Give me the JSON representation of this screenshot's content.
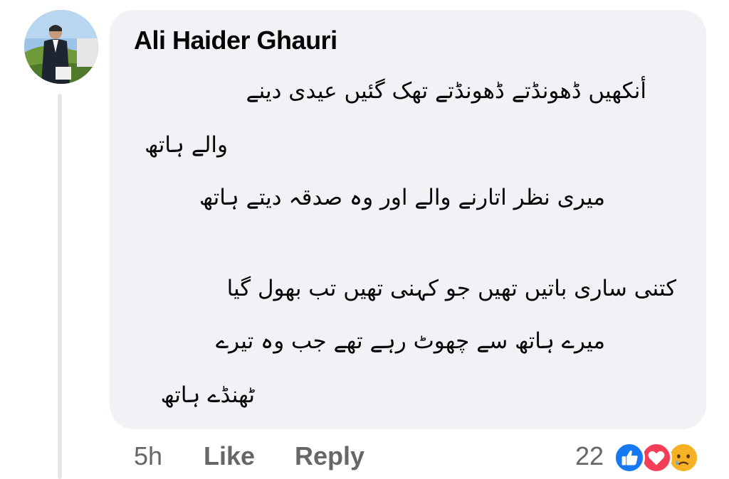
{
  "comment": {
    "author": "Ali Haider Ghauri",
    "body_lines": [
      "أنکھیں ڈھونڈتے ڈھونڈتے تھک گئیں عیدی دینے",
      "والے ہاتھ",
      "میری نظر اتارنے والے اور وہ صدقہ دیتے ہاتھ",
      "کتنی ساری باتیں تھیں جو کہنی تھیں تب بھول گیا",
      "میرے ہاتھ سے چھوٹ رہے تھے جب وہ تیرے",
      "ٹھنڈے ہاتھ"
    ],
    "timestamp": "5h",
    "like_label": "Like",
    "reply_label": "Reply",
    "reaction_count": "22",
    "reactions": [
      "like-icon",
      "love-icon",
      "sad-icon"
    ]
  },
  "colors": {
    "bubble_bg": "#f0f2f5",
    "meta_text": "#65676b",
    "like_blue": "#1877f2",
    "love_red": "#f33e58",
    "sad_yellow": "#f7b125"
  }
}
